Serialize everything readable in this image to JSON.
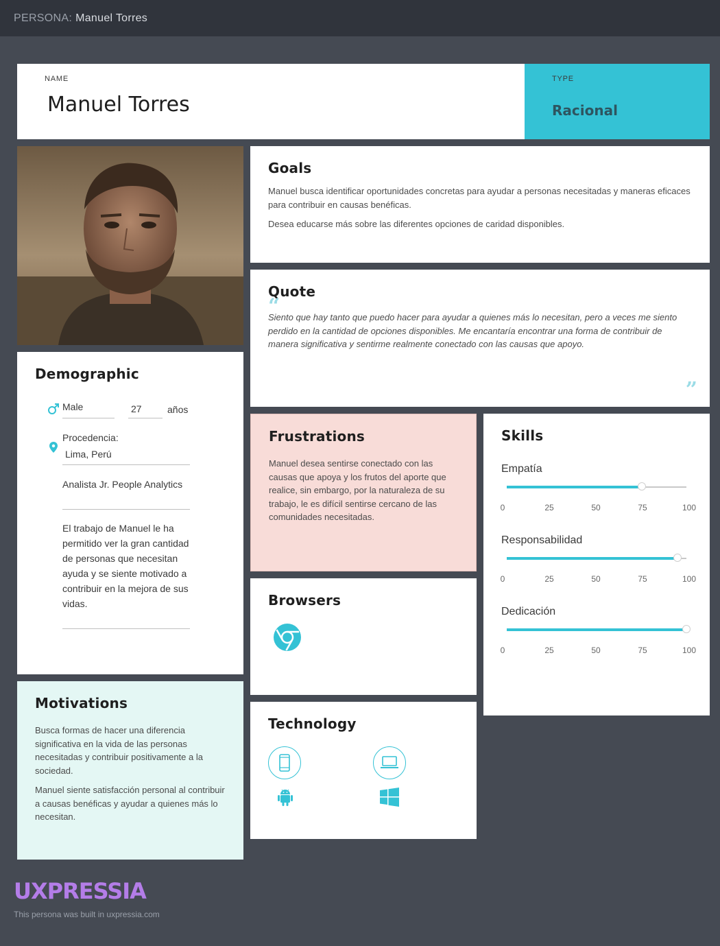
{
  "header": {
    "prefix": "PERSONA:",
    "name": "Manuel Torres"
  },
  "persona": {
    "name_label": "NAME",
    "name": "Manuel Torres",
    "type_label": "TYPE",
    "type": "Racional"
  },
  "goals": {
    "title": "Goals",
    "paragraphs": [
      "Manuel busca identificar oportunidades concretas para ayudar a personas necesitadas y maneras eficaces para contribuir en causas benéficas.",
      "Desea educarse más sobre las diferentes opciones de caridad disponibles."
    ]
  },
  "quote": {
    "title": "Quote",
    "text": "Siento que hay tanto que puedo hacer para ayudar a quienes más lo necesitan, pero a veces me siento perdido en la cantidad de opciones disponibles. Me encantaría encontrar una forma de contribuir de manera significativa y sentirme realmente conectado con las causas que apoyo.",
    "open_mark": "“",
    "close_mark": "”"
  },
  "demographic": {
    "title": "Demographic",
    "gender": "Male",
    "age": "27",
    "age_unit": "años",
    "origin_label": "Procedencia:",
    "origin": "Lima, Perú",
    "job": "Analista Jr. People Analytics",
    "bio": "El trabajo de Manuel le ha permitido ver la gran cantidad de personas que necesitan ayuda y se siente motivado a contribuir en la mejora de sus vidas."
  },
  "frustrations": {
    "title": "Frustrations",
    "text": "Manuel desea sentirse conectado con las causas que apoya y los frutos del aporte que realice, sin embargo, por la naturaleza de su trabajo, le es difícil sentirse cercano de las comunidades necesitadas."
  },
  "skills": {
    "title": "Skills",
    "ticks": [
      "0",
      "25",
      "50",
      "75",
      "100"
    ],
    "items": [
      {
        "name": "Empatía",
        "value": 75
      },
      {
        "name": "Responsabilidad",
        "value": 95
      },
      {
        "name": "Dedicación",
        "value": 100
      }
    ],
    "accent": "#34c2d5"
  },
  "browsers": {
    "title": "Browsers",
    "items": [
      "chrome-icon"
    ]
  },
  "technology": {
    "title": "Technology",
    "items": [
      "smartphone-icon",
      "laptop-icon",
      "android-icon",
      "windows-icon"
    ]
  },
  "motivations": {
    "title": "Motivations",
    "paragraphs": [
      "Busca formas de hacer una diferencia significativa en la vida de las personas necesitadas y contribuir positivamente a la sociedad.",
      "Manuel siente satisfacción personal al contribuir a causas benéficas y ayudar a quienes más lo necesitan."
    ]
  },
  "footer": {
    "logo": "UXPRESSIA",
    "note": "This persona was built in uxpressia.com"
  }
}
